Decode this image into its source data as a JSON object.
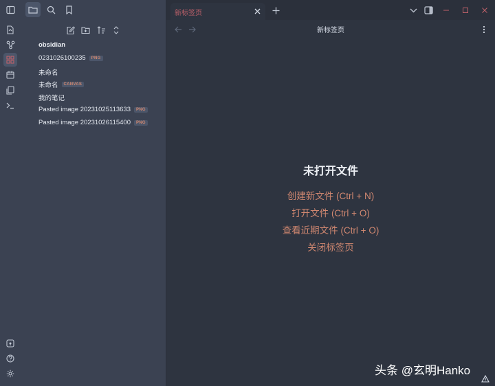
{
  "tabs": [
    {
      "label": "新标签页",
      "active": true
    }
  ],
  "sidebar": {
    "vault_name": "obsidian",
    "files": [
      {
        "name": "0231026100235",
        "ext": "PNG"
      },
      {
        "name": "未命名",
        "ext": ""
      },
      {
        "name": "未命名",
        "ext": "CANVAS"
      },
      {
        "name": "我的笔记",
        "ext": ""
      },
      {
        "name": "Pasted image 20231025113633",
        "ext": "PNG"
      },
      {
        "name": "Pasted image 20231026115400",
        "ext": "PNG"
      }
    ]
  },
  "main": {
    "view_title": "新标签页",
    "empty_title": "未打开文件",
    "actions": [
      "创建新文件 (Ctrl + N)",
      "打开文件 (Ctrl + O)",
      "查看近期文件 (Ctrl + O)",
      "关闭标签页"
    ]
  },
  "watermark": "头条 @玄明Hanko",
  "colors": {
    "accent": "#d08770",
    "tab_label": "#bf616a",
    "background": "#2e3440",
    "sidebar": "#3b4252"
  }
}
